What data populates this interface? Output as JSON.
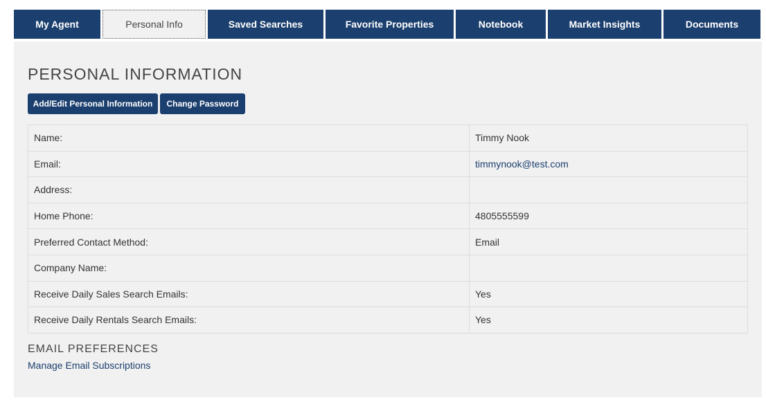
{
  "nav": {
    "tabs": [
      {
        "label": "My Agent"
      },
      {
        "label": "Personal Info",
        "active": true
      },
      {
        "label": "Saved Searches"
      },
      {
        "label": "Favorite Properties"
      },
      {
        "label": "Notebook"
      },
      {
        "label": "Market Insights"
      },
      {
        "label": "Documents"
      }
    ]
  },
  "main": {
    "title": "PERSONAL INFORMATION",
    "buttons": {
      "add_edit": "Add/Edit Personal Information",
      "change_password": "Change Password"
    },
    "fields": [
      {
        "label": "Name:",
        "value": "Timmy Nook"
      },
      {
        "label": "Email:",
        "value": "timmynook@test.com"
      },
      {
        "label": "Address:",
        "value": ""
      },
      {
        "label": "Home Phone:",
        "value": "4805555599"
      },
      {
        "label": "Preferred Contact Method:",
        "value": "Email"
      },
      {
        "label": "Company Name:",
        "value": ""
      },
      {
        "label": "Receive Daily Sales Search Emails:",
        "value": "Yes"
      },
      {
        "label": "Receive Daily Rentals Search Emails:",
        "value": "Yes"
      }
    ],
    "email_preferences": {
      "title": "EMAIL PREFERENCES",
      "link": "Manage Email Subscriptions"
    }
  },
  "colors": {
    "brand_navy": "#1b3f6e",
    "panel_bg": "#f1f1f1"
  }
}
